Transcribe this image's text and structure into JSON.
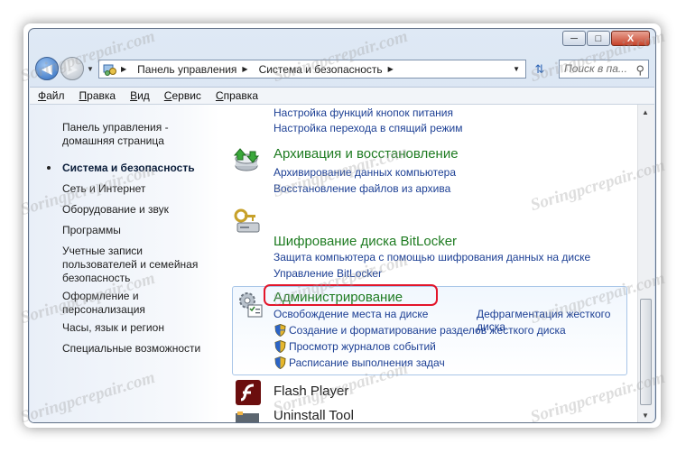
{
  "window": {
    "minimize": "─",
    "maximize": "□",
    "close": "X"
  },
  "address": {
    "crumbs": [
      "Панель управления",
      "Система и безопасность"
    ],
    "search_placeholder": "Поиск в па..."
  },
  "menu": [
    "Файл",
    "Правка",
    "Вид",
    "Сервис",
    "Справка"
  ],
  "sidebar": {
    "home_line1": "Панель управления -",
    "home_line2": "домашняя страница",
    "items": [
      "Система и безопасность",
      "Сеть и Интернет",
      "Оборудование и звук",
      "Программы"
    ],
    "accounts": [
      "Учетные записи",
      "пользователей и семейная",
      "безопасность"
    ],
    "appearance": [
      "Оформление и",
      "персонализация"
    ],
    "clock": "Часы, язык и регион",
    "access": "Специальные возможности"
  },
  "power": {
    "links": [
      "Настройка функций кнопок питания",
      "Настройка перехода в спящий режим"
    ]
  },
  "backup": {
    "title": "Архивация и восстановление",
    "links": [
      "Архивирование данных компьютера",
      "Восстановление файлов из архива"
    ]
  },
  "bitlocker": {
    "title": "Шифрование диска BitLocker",
    "links": [
      "Защита компьютера с помощью шифрования данных на диске",
      "Управление BitLocker"
    ]
  },
  "admin": {
    "title": "Администрирование",
    "link1": "Освобождение места на диске",
    "link2": "Дефрагментация жесткого диска",
    "shield_links": [
      "Создание и форматирование разделов жесткого диска",
      "Просмотр журналов событий",
      "Расписание выполнения задач"
    ]
  },
  "flash": {
    "title": "Flash Player"
  },
  "uninstall": {
    "title": "Uninstall Tool"
  },
  "watermark": "Soringpcrepair.com",
  "colors": {
    "heading": "#1f7c22",
    "link": "#1c3f94",
    "highlight_border": "#e3152a"
  }
}
